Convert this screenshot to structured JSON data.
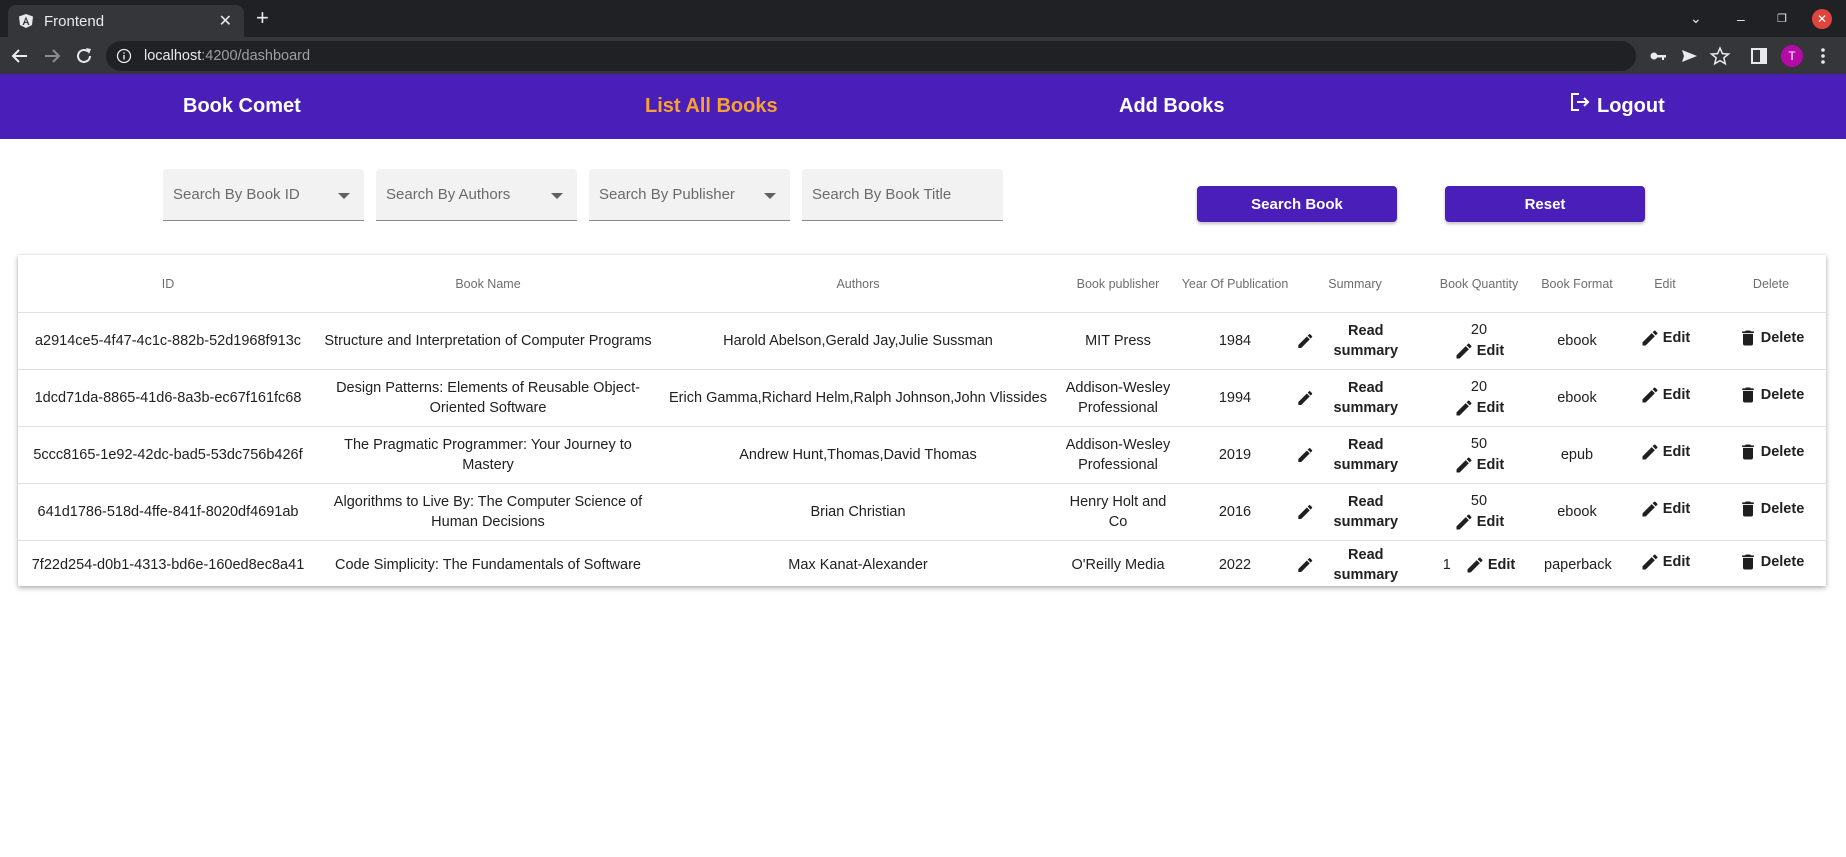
{
  "browser": {
    "tab_title": "Frontend",
    "url_host": "localhost",
    "url_path": ":4200/dashboard",
    "avatar_letter": "T"
  },
  "nav": {
    "brand": "Book Comet",
    "list_all": "List All Books",
    "add_books": "Add Books",
    "logout": "Logout",
    "active_color": "#f7a233",
    "bar_color": "#4a1eb8"
  },
  "search": {
    "book_id_placeholder": "Search By Book ID",
    "authors_placeholder": "Search By Authors",
    "publisher_placeholder": "Search By Publisher",
    "title_placeholder": "Search By Book Title",
    "search_button": "Search Book",
    "reset_button": "Reset"
  },
  "table": {
    "headers": [
      "ID",
      "Book Name",
      "Authors",
      "Book publisher",
      "Year Of Publication",
      "Summary",
      "Book Quantity",
      "Book Format",
      "Edit",
      "Delete"
    ],
    "action_labels": {
      "summary": "Read summary",
      "edit": "Edit",
      "delete": "Delete"
    },
    "rows": [
      {
        "id": "a2914ce5-4f47-4c1c-882b-52d1968f913c",
        "name": "Structure and Interpretation of Computer Programs",
        "authors": "Harold Abelson,Gerald Jay,Julie Sussman",
        "publisher": "MIT Press",
        "year": "1984",
        "quantity": "20",
        "format": "ebook"
      },
      {
        "id": "1dcd71da-8865-41d6-8a3b-ec67f161fc68",
        "name": "Design Patterns: Elements of Reusable Object-Oriented Software",
        "authors": "Erich Gamma,Richard Helm,Ralph Johnson,John Vlissides",
        "publisher": "Addison-Wesley Professional",
        "year": "1994",
        "quantity": "20",
        "format": "ebook"
      },
      {
        "id": "5ccc8165-1e92-42dc-bad5-53dc756b426f",
        "name": "The Pragmatic Programmer: Your Journey to Mastery",
        "authors": "Andrew Hunt,Thomas,David Thomas",
        "publisher": "Addison-Wesley Professional",
        "year": "2019",
        "quantity": "50",
        "format": "epub"
      },
      {
        "id": "641d1786-518d-4ffe-841f-8020df4691ab",
        "name": "Algorithms to Live By: The Computer Science of Human Decisions",
        "authors": "Brian Christian",
        "publisher": "Henry Holt and Co",
        "year": "2016",
        "quantity": "50",
        "format": "ebook"
      },
      {
        "id": "7f22d254-d0b1-4313-bd6e-160ed8ec8a41",
        "name": "Code Simplicity: The Fundamentals of Software",
        "authors": "Max Kanat-Alexander",
        "publisher": "O'Reilly Media",
        "year": "2022",
        "quantity": "1",
        "format": "paperback"
      }
    ]
  }
}
